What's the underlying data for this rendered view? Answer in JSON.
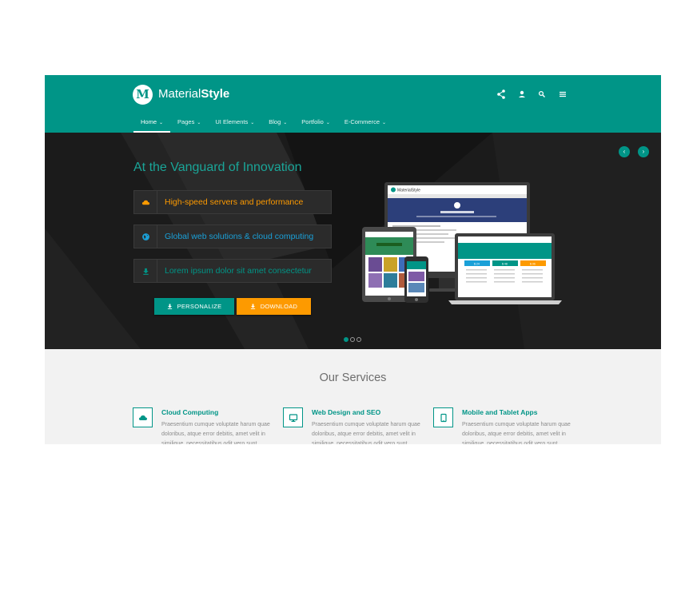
{
  "header": {
    "logo_letter": "M",
    "brand_light": "Material",
    "brand_bold": "Style",
    "icons": [
      "share-icon",
      "user-icon",
      "search-icon",
      "menu-icon"
    ]
  },
  "nav": {
    "items": [
      {
        "label": "Home",
        "active": true
      },
      {
        "label": "Pages"
      },
      {
        "label": "UI Elements"
      },
      {
        "label": "Blog"
      },
      {
        "label": "Portfolio"
      },
      {
        "label": "E-Commerce"
      }
    ],
    "chevron": "⌄"
  },
  "hero": {
    "title": "At the Vanguard of Innovation",
    "features": [
      {
        "icon": "cloud-icon",
        "text": "High-speed servers and performance",
        "color": "#fd9a00"
      },
      {
        "icon": "globe-icon",
        "text": "Global web solutions & cloud computing",
        "color": "#1aa0d8"
      },
      {
        "icon": "download-icon",
        "text": "Lorem ipsum dolor sit amet consectetur",
        "color": "#009587"
      }
    ],
    "personalize_label": "PERSONALIZE",
    "download_label": "DOWNLOAD",
    "prev_arrow": "‹",
    "next_arrow": "›",
    "slides_count": 3,
    "active_slide": 1
  },
  "mockup": {
    "brand": "MaterialStyle",
    "pricing": [
      "$ 24",
      "$ 48",
      "$ 96"
    ]
  },
  "services": {
    "title": "Our Services",
    "items": [
      {
        "icon": "cloud-icon",
        "title": "Cloud Computing",
        "desc": "Praesentium cumque voluptate harum quae doloribus, atque error debitis, amet velit in similique, necessitatibus odit vero sunt."
      },
      {
        "icon": "monitor-icon",
        "title": "Web Design and SEO",
        "desc": "Praesentium cumque voluptate harum quae doloribus, atque error debitis, amet velit in similique, necessitatibus odit vero sunt."
      },
      {
        "icon": "tablet-icon",
        "title": "Mobile and Tablet Apps",
        "desc": "Praesentium cumque voluptate harum quae doloribus, atque error debitis, amet velit in similique, necessitatibus odit vero sunt."
      }
    ]
  },
  "colors": {
    "accent": "#009587",
    "orange": "#fd9a00",
    "blue": "#1aa0d8",
    "hero_bg": "#1b1b1b",
    "section_bg": "#f2f2f2"
  }
}
